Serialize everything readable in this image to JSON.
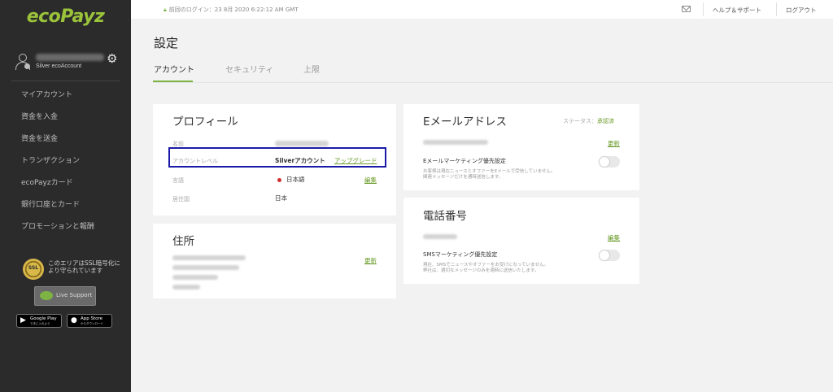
{
  "brand": {
    "logo_text": "ecoPayz",
    "accent_color": "#7cb342"
  },
  "sidebar": {
    "user": {
      "account_type": "Silver ecoAccount"
    },
    "items": [
      {
        "label": "マイアカウント"
      },
      {
        "label": "資金を入金"
      },
      {
        "label": "資金を送金"
      },
      {
        "label": "トランザクション"
      },
      {
        "label": "ecoPayzカード"
      },
      {
        "label": "銀行口座とカード"
      },
      {
        "label": "プロモーションと報酬"
      }
    ],
    "ssl": {
      "badge": "SSL",
      "text": "このエリアはSSL暗号化により守られています"
    },
    "live_support": "Live Support",
    "google_play": {
      "line1": "Google Play",
      "line2": "で手に入れよう"
    },
    "app_store": {
      "line1": "App Store",
      "line2": "からダウンロード"
    }
  },
  "topbar": {
    "last_login": "前回のログイン：23 8月 2020 6:22:12 AM GMT",
    "help": "ヘルプ＆サポート",
    "logout": "ログアウト"
  },
  "page": {
    "title": "設定",
    "tabs": [
      {
        "label": "アカウント",
        "active": true
      },
      {
        "label": "セキュリティ",
        "active": false
      },
      {
        "label": "上限",
        "active": false
      }
    ]
  },
  "profile": {
    "title": "プロフィール",
    "name_label": "名前",
    "level_label": "アカウントレベル",
    "level_value": "Silverアカウント",
    "upgrade": "アップグレード",
    "language_label": "言語",
    "language_value": "日本語",
    "edit": "編集",
    "country_label": "居住国",
    "country_value": "日本"
  },
  "address": {
    "title": "住所",
    "update": "更新"
  },
  "email": {
    "title": "Eメールアドレス",
    "status_label": "ステータス：",
    "status_value": "承認済",
    "update": "更新",
    "marketing_title": "Eメールマーケティング優先設定",
    "marketing_desc_1": "お客様は現在ニュースとオファーをEメールで受信していません。",
    "marketing_desc_2": "関連メッセージだけを通時送信します。"
  },
  "phone": {
    "title": "電話番号",
    "edit": "編集",
    "sms_title": "SMSマーケティング優先設定",
    "sms_desc_1": "現在、SMSでニュースやオファーをお受けになっていません。",
    "sms_desc_2": "弊社は、適切なメッセージのみを適時に送信いたします。"
  }
}
